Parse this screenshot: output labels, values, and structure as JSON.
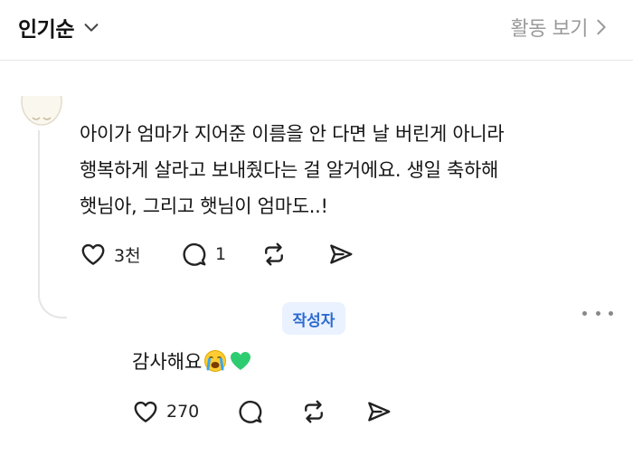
{
  "header": {
    "sort_label": "인기순",
    "sort_icon": "chevron-down-icon",
    "activity_label": "활동 보기",
    "activity_icon": "chevron-right-icon"
  },
  "comment": {
    "lines": [
      "아이가 엄마가 지어준 이름을 안 다면 날 버린게 아니라",
      "행복하게 살라고 보내줬다는 걸 알거에요. 생일 축하해",
      "햇님아, 그리고 햇님이 엄마도..!"
    ],
    "like_count": "3천",
    "comment_count": "1"
  },
  "reply": {
    "badge": "작성자",
    "text": "감사해요",
    "emojis": [
      "loudly-crying-face",
      "green-heart"
    ],
    "like_count": "270"
  },
  "colors": {
    "badge_bg": "#eaf2ff",
    "badge_text": "#2d6ad0",
    "muted": "#9a9a9a",
    "divider": "#e6e6e6",
    "heart_green": "#2ecc71"
  }
}
